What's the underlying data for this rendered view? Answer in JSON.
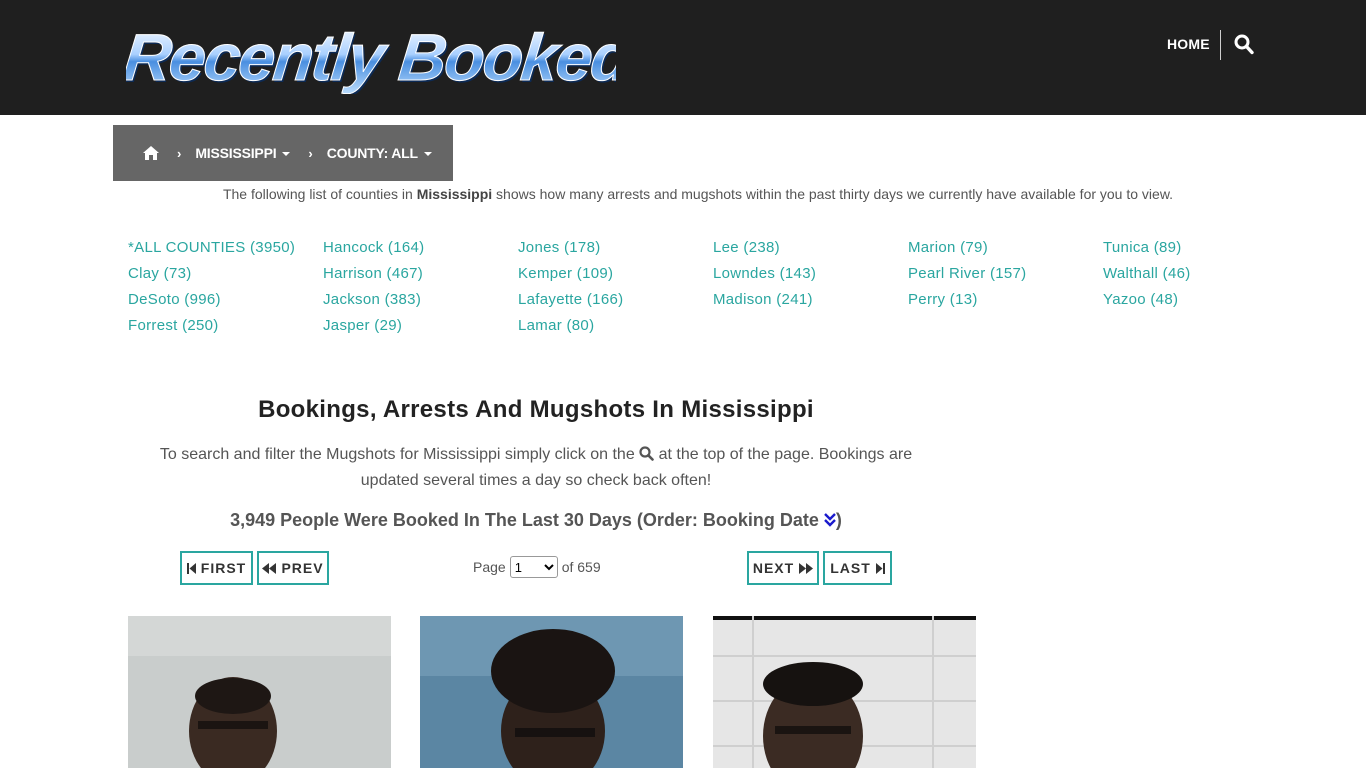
{
  "header": {
    "logo_text": "Recently Booked",
    "nav_home": "HOME"
  },
  "breadcrumb": {
    "state": "MISSISSIPPI",
    "county": "COUNTY: ALL"
  },
  "intro": {
    "pre": "The following list of counties in ",
    "state": "Mississippi",
    "post": " shows how many arrests and mugshots within the past thirty days we currently have available for you to view."
  },
  "counties": {
    "col1": [
      "*ALL COUNTIES (3950)",
      "Clay (73)",
      "DeSoto (996)",
      "Forrest (250)"
    ],
    "col2": [
      "Hancock (164)",
      "Harrison (467)",
      "Jackson (383)",
      "Jasper (29)"
    ],
    "col3": [
      "Jones (178)",
      "Kemper (109)",
      "Lafayette (166)",
      "Lamar (80)"
    ],
    "col4": [
      "Lee (238)",
      "Lowndes (143)",
      "Madison (241)"
    ],
    "col5": [
      "Marion (79)",
      "Pearl River (157)",
      "Perry (13)"
    ],
    "col6": [
      "Tunica (89)",
      "Walthall (46)",
      "Yazoo (48)"
    ]
  },
  "section": {
    "title": "Bookings, Arrests And Mugshots In Mississippi",
    "desc_pre": "To search and filter the Mugshots for Mississippi simply click on the ",
    "desc_post": " at the top of the page. Bookings are updated several times a day so check back often!",
    "booked_pre": "3,949 People Were Booked In The Last 30 Days (Order: Booking Date ",
    "booked_post": ")"
  },
  "pagination": {
    "first": "FIRST",
    "prev": "PREV",
    "next": "NEXT",
    "last": "LAST",
    "page_label": "Page",
    "current_page": "1",
    "of_label": "of 659"
  },
  "colors": {
    "header_bg": "#1f1f1f",
    "breadcrumb_bg": "#666666",
    "accent_teal": "#2aa6a0",
    "sort_icon_blue": "#1a1acc"
  },
  "icons": {
    "search": "search-icon",
    "home": "home-icon",
    "breadcrumb_separator": "chevron-right-icon",
    "sort": "double-chevron-down-icon"
  }
}
